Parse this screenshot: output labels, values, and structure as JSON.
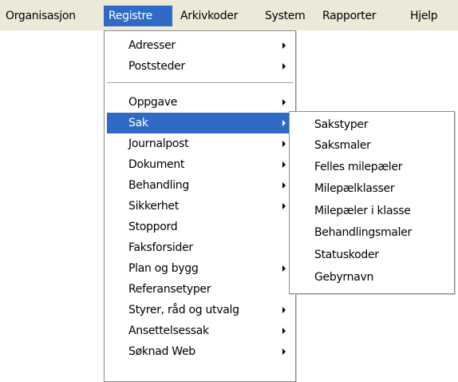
{
  "menubar": {
    "items": [
      {
        "label": "Organisasjon"
      },
      {
        "label": "Registre"
      },
      {
        "label": "Arkivkoder"
      },
      {
        "label": "System"
      },
      {
        "label": "Rapporter"
      },
      {
        "label": "Hjelp"
      }
    ]
  },
  "registre_menu": {
    "items": [
      {
        "label": "Adresser",
        "has_submenu": true
      },
      {
        "label": "Poststeder",
        "has_submenu": true
      },
      {
        "label": "Oppgave",
        "has_submenu": true
      },
      {
        "label": "Sak",
        "has_submenu": true,
        "selected": true
      },
      {
        "label": "Journalpost",
        "has_submenu": true
      },
      {
        "label": "Dokument",
        "has_submenu": true
      },
      {
        "label": "Behandling",
        "has_submenu": true
      },
      {
        "label": "Sikkerhet",
        "has_submenu": true
      },
      {
        "label": "Stoppord",
        "has_submenu": false
      },
      {
        "label": "Faksforsider",
        "has_submenu": false
      },
      {
        "label": "Plan og bygg",
        "has_submenu": true
      },
      {
        "label": "Referansetyper",
        "has_submenu": false
      },
      {
        "label": "Styrer, råd og utvalg",
        "has_submenu": true
      },
      {
        "label": "Ansettelsessak",
        "has_submenu": true
      },
      {
        "label": "Søknad Web",
        "has_submenu": true
      }
    ]
  },
  "sak_submenu": {
    "items": [
      {
        "label": "Sakstyper"
      },
      {
        "label": "Saksmaler"
      },
      {
        "label": "Felles milepæler"
      },
      {
        "label": "Milepælklasser"
      },
      {
        "label": "Milepæler i klasse"
      },
      {
        "label": "Behandlingsmaler"
      },
      {
        "label": "Statuskoder"
      },
      {
        "label": "Gebyrnavn"
      }
    ]
  },
  "colors": {
    "menubar_bg": "#ece9d8",
    "highlight": "#316ac5",
    "highlight_text": "#ffffff"
  }
}
